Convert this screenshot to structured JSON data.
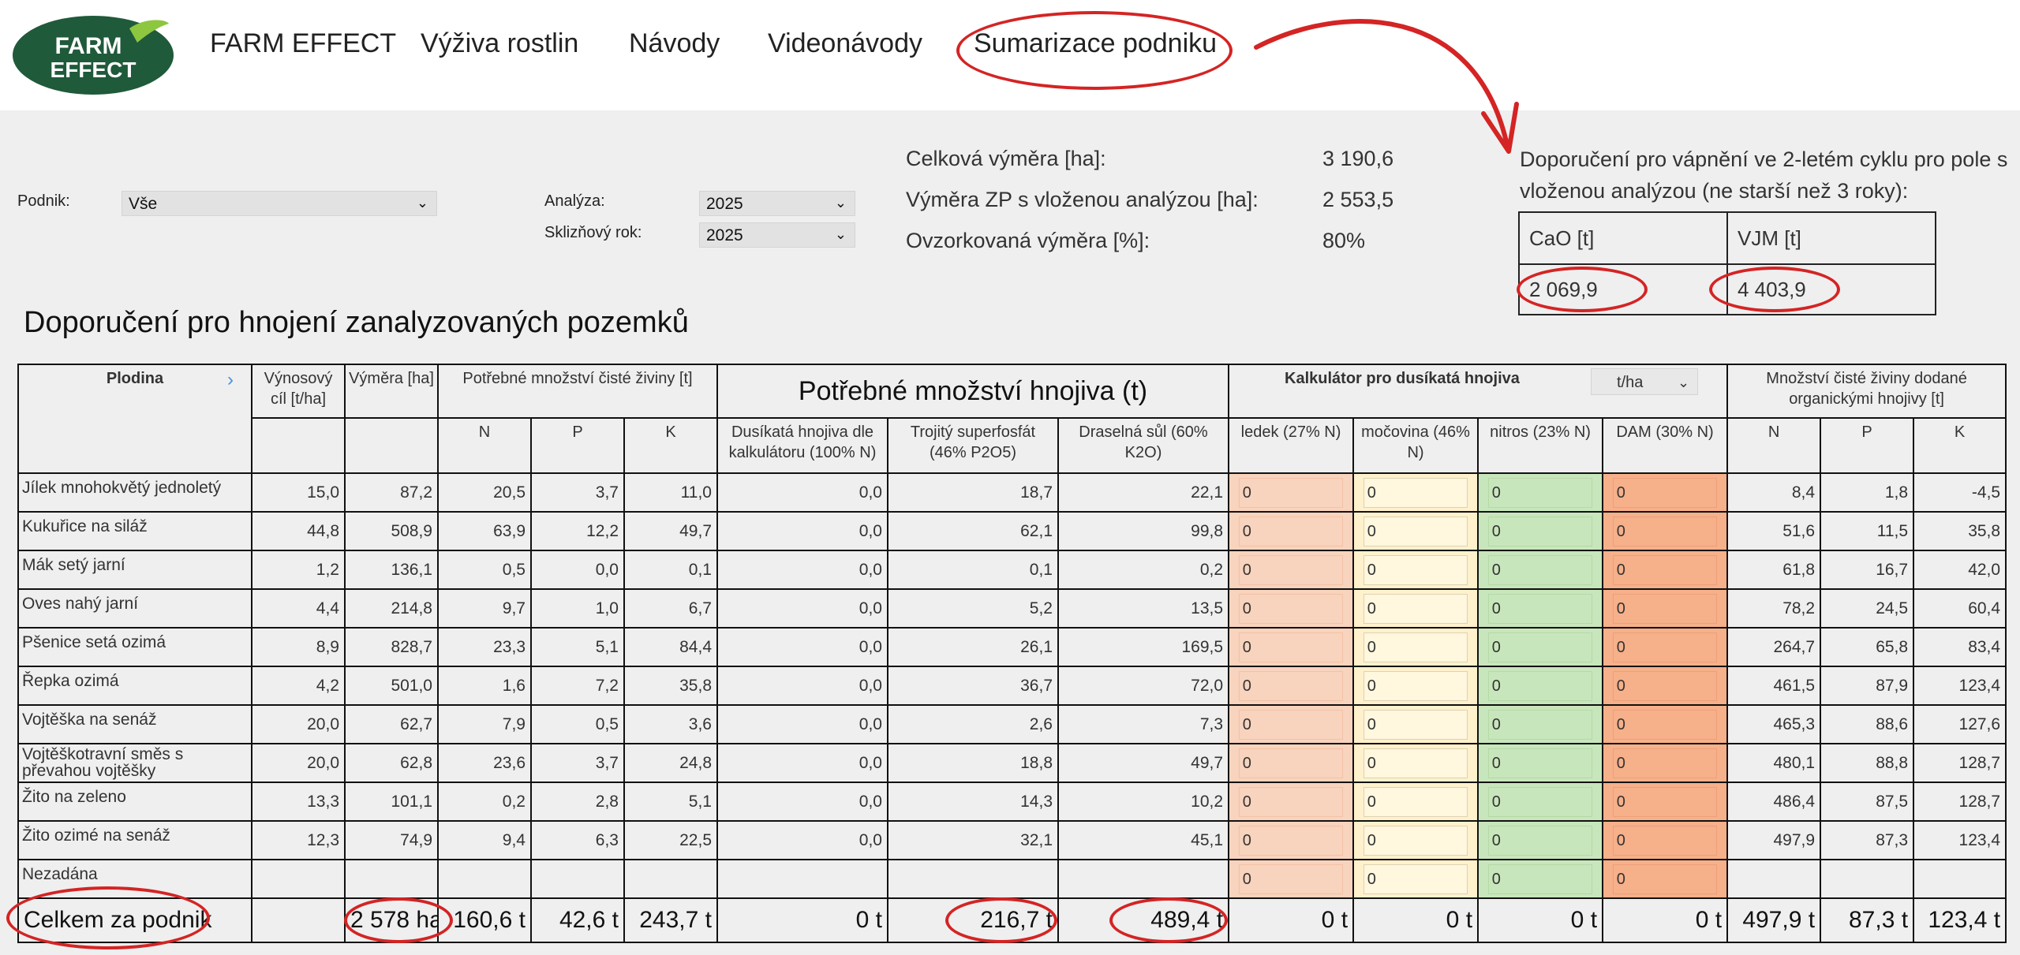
{
  "brand": {
    "logo_line1": "FARM",
    "logo_line2": "EFFECT"
  },
  "nav": {
    "items": [
      "FARM EFFECT",
      "Výživa rostlin",
      "Návody",
      "Videonávody",
      "Sumarizace podniku"
    ]
  },
  "filters": {
    "podnik_label": "Podnik:",
    "podnik_value": "Vše",
    "analyza_label": "Analýza:",
    "analyza_value": "2025",
    "sklizen_label": "Sklizňový rok:",
    "sklizen_value": "2025"
  },
  "stats": {
    "celkova_label": "Celková výměra [ha]:",
    "celkova_value": "3 190,6",
    "zp_label": "Výměra ZP s vloženou analýzou [ha]:",
    "zp_value": "2 553,5",
    "ovz_label": "Ovzorkovaná výměra [%]:",
    "ovz_value": "80%"
  },
  "liming": {
    "title": "Doporučení pro vápnění ve 2-letém cyklu pro pole s vloženou analýzou (ne starší než 3 roky):",
    "cao_header": "CaO [t]",
    "vjm_header": "VJM [t]",
    "cao_value": "2 069,9",
    "vjm_value": "4 403,9"
  },
  "section_title": "Doporučení pro hnojení zanalyzovaných pozemků",
  "headers": {
    "plodina": "Plodina",
    "vynosovy_cil": "Výnosový cíl [t/ha]",
    "vymera": "Výměra [ha]",
    "potrebne_ciste": "Potřebné množství čisté živiny [t]",
    "potrebne_hnojiva": "Potřebné množství hnojiva (t)",
    "kalkulator": "Kalkulátor pro dusíkatá hnojiva",
    "unit_select": "t/ha",
    "organicke": "Množství čisté živiny dodané organickými hnojivy [t]",
    "n": "N",
    "p": "P",
    "k": "K",
    "dusikata": "Dusíkatá hnojiva dle kalkulátoru (100% N)",
    "trojity": "Trojitý superfosfát (46% P2O5)",
    "draselna": "Draselná sůl (60% K2O)",
    "ledek": "ledek (27% N)",
    "mocovina": "močovina (46% N)",
    "nitros": "nitros (23% N)",
    "dam": "DAM (30% N)"
  },
  "rows": [
    {
      "plodina": "Jílek mnohokvětý jednoletý",
      "cil": "15,0",
      "vymera": "87,2",
      "n": "20,5",
      "p": "3,7",
      "k": "11,0",
      "dus": "0,0",
      "troj": "18,7",
      "dras": "22,1",
      "ledek": "0",
      "mocovina": "0",
      "nitros": "0",
      "dam": "0",
      "on": "8,4",
      "op": "1,8",
      "ok": "-4,5"
    },
    {
      "plodina": "Kukuřice na siláž",
      "cil": "44,8",
      "vymera": "508,9",
      "n": "63,9",
      "p": "12,2",
      "k": "49,7",
      "dus": "0,0",
      "troj": "62,1",
      "dras": "99,8",
      "ledek": "0",
      "mocovina": "0",
      "nitros": "0",
      "dam": "0",
      "on": "51,6",
      "op": "11,5",
      "ok": "35,8"
    },
    {
      "plodina": "Mák setý jarní",
      "cil": "1,2",
      "vymera": "136,1",
      "n": "0,5",
      "p": "0,0",
      "k": "0,1",
      "dus": "0,0",
      "troj": "0,1",
      "dras": "0,2",
      "ledek": "0",
      "mocovina": "0",
      "nitros": "0",
      "dam": "0",
      "on": "61,8",
      "op": "16,7",
      "ok": "42,0"
    },
    {
      "plodina": "Oves nahý jarní",
      "cil": "4,4",
      "vymera": "214,8",
      "n": "9,7",
      "p": "1,0",
      "k": "6,7",
      "dus": "0,0",
      "troj": "5,2",
      "dras": "13,5",
      "ledek": "0",
      "mocovina": "0",
      "nitros": "0",
      "dam": "0",
      "on": "78,2",
      "op": "24,5",
      "ok": "60,4"
    },
    {
      "plodina": "Pšenice setá ozimá",
      "cil": "8,9",
      "vymera": "828,7",
      "n": "23,3",
      "p": "5,1",
      "k": "84,4",
      "dus": "0,0",
      "troj": "26,1",
      "dras": "169,5",
      "ledek": "0",
      "mocovina": "0",
      "nitros": "0",
      "dam": "0",
      "on": "264,7",
      "op": "65,8",
      "ok": "83,4"
    },
    {
      "plodina": "Řepka ozimá",
      "cil": "4,2",
      "vymera": "501,0",
      "n": "1,6",
      "p": "7,2",
      "k": "35,8",
      "dus": "0,0",
      "troj": "36,7",
      "dras": "72,0",
      "ledek": "0",
      "mocovina": "0",
      "nitros": "0",
      "dam": "0",
      "on": "461,5",
      "op": "87,9",
      "ok": "123,4"
    },
    {
      "plodina": "Vojtěška na senáž",
      "cil": "20,0",
      "vymera": "62,7",
      "n": "7,9",
      "p": "0,5",
      "k": "3,6",
      "dus": "0,0",
      "troj": "2,6",
      "dras": "7,3",
      "ledek": "0",
      "mocovina": "0",
      "nitros": "0",
      "dam": "0",
      "on": "465,3",
      "op": "88,6",
      "ok": "127,6"
    },
    {
      "plodina": "Vojtěškotravní směs s převahou vojtěšky",
      "cil": "20,0",
      "vymera": "62,8",
      "n": "23,6",
      "p": "3,7",
      "k": "24,8",
      "dus": "0,0",
      "troj": "18,8",
      "dras": "49,7",
      "ledek": "0",
      "mocovina": "0",
      "nitros": "0",
      "dam": "0",
      "on": "480,1",
      "op": "88,8",
      "ok": "128,7"
    },
    {
      "plodina": "Žito na zeleno",
      "cil": "13,3",
      "vymera": "101,1",
      "n": "0,2",
      "p": "2,8",
      "k": "5,1",
      "dus": "0,0",
      "troj": "14,3",
      "dras": "10,2",
      "ledek": "0",
      "mocovina": "0",
      "nitros": "0",
      "dam": "0",
      "on": "486,4",
      "op": "87,5",
      "ok": "128,7"
    },
    {
      "plodina": "Žito ozimé na senáž",
      "cil": "12,3",
      "vymera": "74,9",
      "n": "9,4",
      "p": "6,3",
      "k": "22,5",
      "dus": "0,0",
      "troj": "32,1",
      "dras": "45,1",
      "ledek": "0",
      "mocovina": "0",
      "nitros": "0",
      "dam": "0",
      "on": "497,9",
      "op": "87,3",
      "ok": "123,4"
    },
    {
      "plodina": "Nezadána",
      "cil": "",
      "vymera": "",
      "n": "",
      "p": "",
      "k": "",
      "dus": "",
      "troj": "",
      "dras": "",
      "ledek": "0",
      "mocovina": "0",
      "nitros": "0",
      "dam": "0",
      "on": "",
      "op": "",
      "ok": ""
    }
  ],
  "totals": {
    "label": "Celkem za podnik",
    "vymera": "2 578 ha",
    "n": "160,6 t",
    "p": "42,6 t",
    "k": "243,7 t",
    "dus": "0 t",
    "troj": "216,7 t",
    "dras": "489,4 t",
    "ledek": "0 t",
    "mocovina": "0 t",
    "nitros": "0 t",
    "dam": "0 t",
    "on": "497,9 t",
    "op": "87,3 t",
    "ok": "123,4 t"
  },
  "colors": {
    "brand_green": "#1f5a3a",
    "annotation_red": "#d42424",
    "ledek": "#f8d3bd",
    "mocovina": "#fff1cc",
    "nitros": "#c8e6bb",
    "dam": "#f6b08a"
  }
}
